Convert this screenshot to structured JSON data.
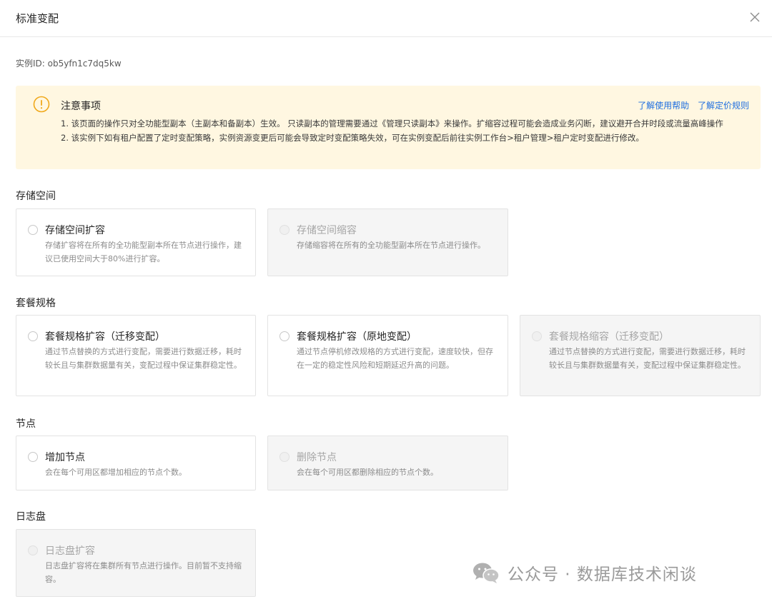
{
  "dialog": {
    "title": "标准变配"
  },
  "instance_label": "实例ID: ob5yfn1c7dq5kw",
  "notice": {
    "title": "注意事项",
    "link_help": "了解使用帮助",
    "link_price": "了解定价规则",
    "line1": "1. 该页面的操作只对全功能型副本（主副本和备副本）生效。 只读副本的管理需要通过《管理只读副本》来操作。扩缩容过程可能会造成业务闪断，建议避开合并时段或流量高峰操作",
    "line2": "2. 该实例下如有租户配置了定时变配策略，实例资源变更后可能会导致定时变配策略失效，可在实例变配后前往实例工作台>租户管理>租户定时变配进行修改。"
  },
  "sections": {
    "storage": {
      "title": "存储空间",
      "expand": {
        "title": "存储空间扩容",
        "desc": "存储扩容将在所有的全功能型副本所在节点进行操作，建议已使用空间大于80%进行扩容。"
      },
      "shrink": {
        "title": "存储空间缩容",
        "desc": "存储缩容将在所有的全功能型副本所在节点进行操作。"
      }
    },
    "spec": {
      "title": "套餐规格",
      "expand_migrate": {
        "title": "套餐规格扩容（迁移变配）",
        "desc": "通过节点替换的方式进行变配，需要进行数据迁移，耗时较长且与集群数据量有关，变配过程中保证集群稳定性。"
      },
      "expand_inplace": {
        "title": "套餐规格扩容（原地变配）",
        "desc": "通过节点停机修改规格的方式进行变配，速度较快，但存在一定的稳定性风险和短期延迟升高的问题。"
      },
      "shrink_migrate": {
        "title": "套餐规格缩容（迁移变配）",
        "desc": "通过节点替换的方式进行变配，需要进行数据迁移，耗时较长且与集群数据量有关，变配过程中保证集群稳定性。"
      }
    },
    "node": {
      "title": "节点",
      "add": {
        "title": "增加节点",
        "desc": "会在每个可用区都增加相应的节点个数。"
      },
      "remove": {
        "title": "删除节点",
        "desc": "会在每个可用区都删除相应的节点个数。"
      }
    },
    "log": {
      "title": "日志盘",
      "expand": {
        "title": "日志盘扩容",
        "desc": "日志盘扩容将在集群所有节点进行操作。目前暂不支持缩容。"
      }
    }
  },
  "watermark": "公众号 · 数据库技术闲谈",
  "colors": {
    "accent": "#1f6fe0",
    "warning": "#f0a81a",
    "notice_bg": "#fff7e1",
    "disabled_bg": "#f5f5f5"
  }
}
